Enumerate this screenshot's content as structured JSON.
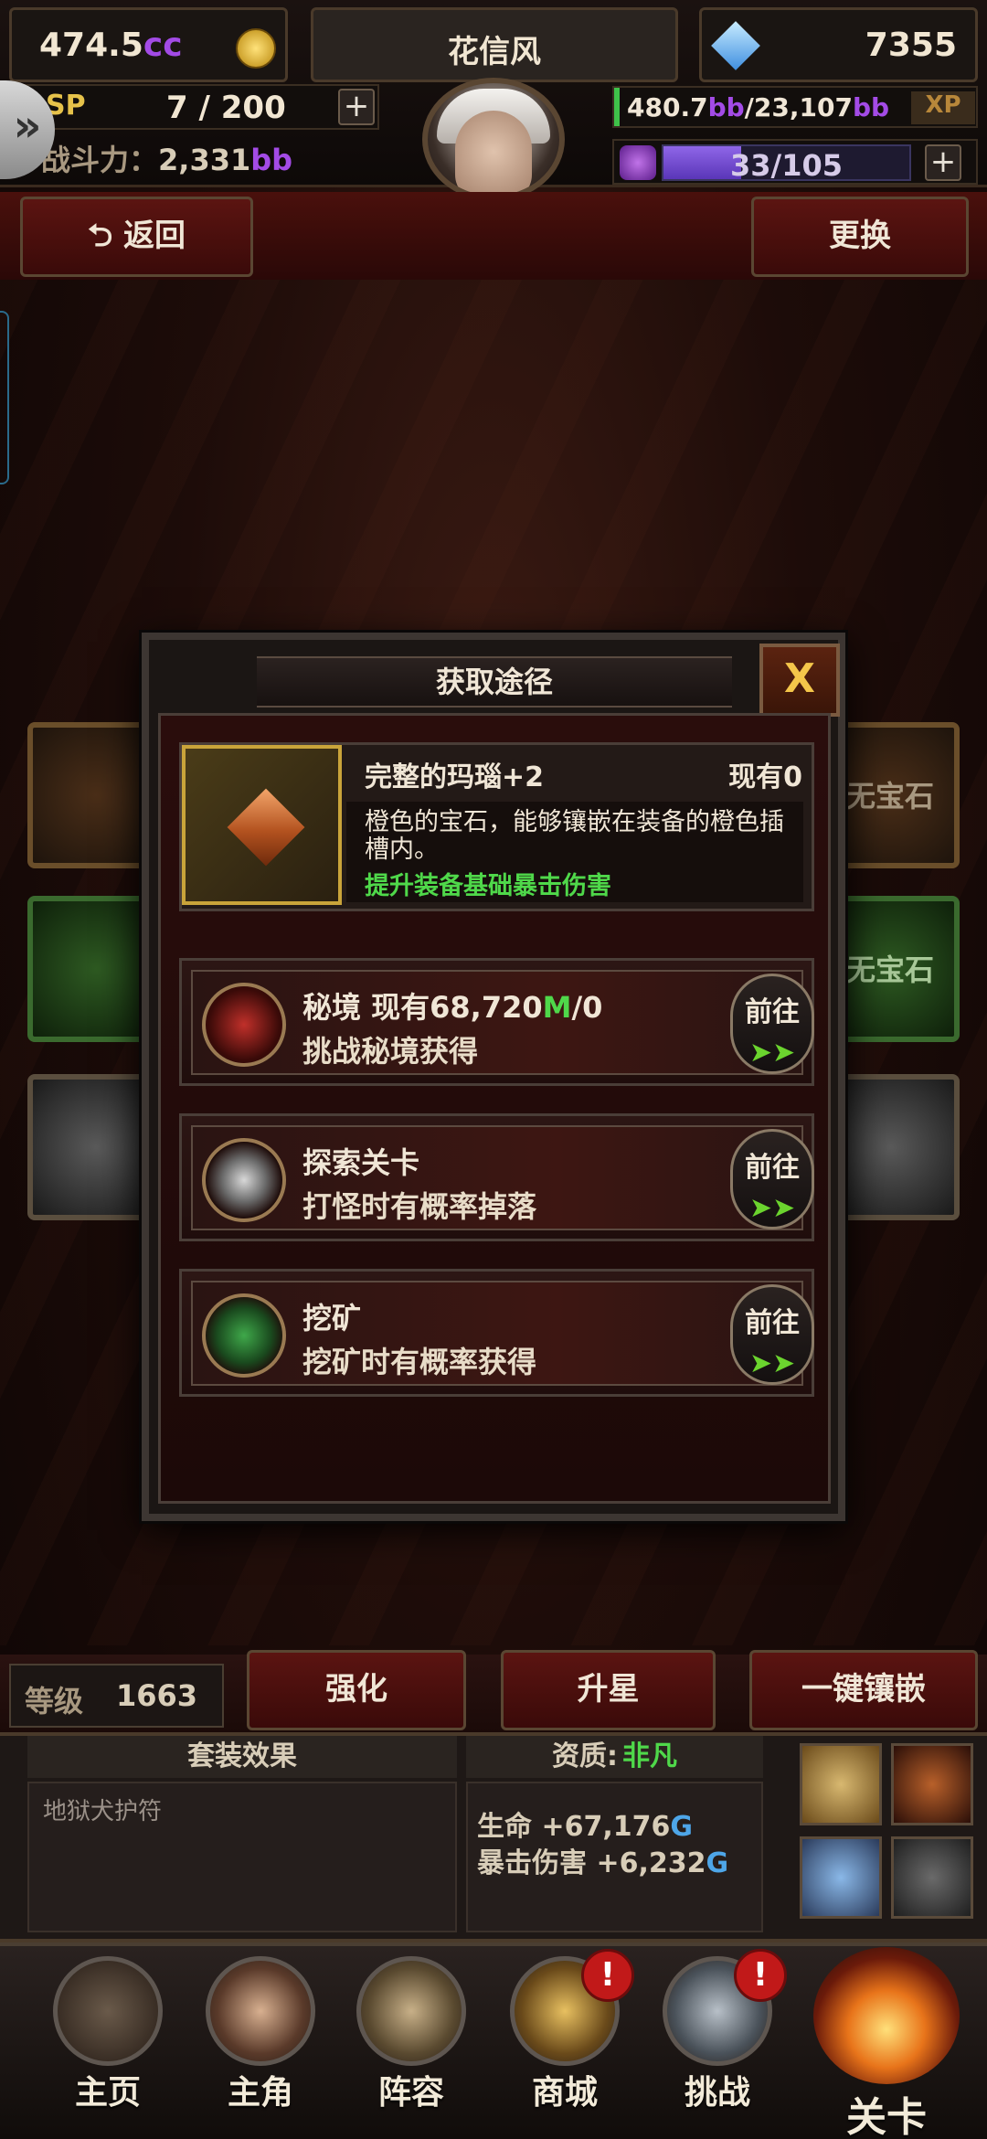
{
  "header": {
    "currency_cc": {
      "value": "474.5",
      "unit": "cc"
    },
    "player_name": "花信风",
    "diamonds": "7355",
    "sp_label": "SP",
    "sp_value": "7 / 200",
    "power_label": "战斗力：",
    "power_value": "2,331",
    "power_unit": "bb",
    "xp_current": "480.7",
    "xp_unit": "bb",
    "xp_sep": "/",
    "xp_max": "23,107",
    "xp_label": "XP",
    "gem_count": "33",
    "gem_max": "/105",
    "plus": "+"
  },
  "nav_top": {
    "back_label": "返回",
    "swap_label": "更换"
  },
  "dialog": {
    "title": "获取途径",
    "close": "X",
    "item": {
      "name": "完整的玛瑙+2",
      "owned": "现有0",
      "desc": "橙色的宝石，能够镶嵌在装备的橙色插槽内。",
      "effect": "提升装备基础暴击伤害"
    },
    "routes": [
      {
        "title": "秘境 现有68,720",
        "title_unit": "M",
        "title_tail": "/0",
        "sub": "挑战秘境获得",
        "go": "前往",
        "icon": "secret-realm-icon"
      },
      {
        "title": "探索关卡",
        "sub": "打怪时有概率掉落",
        "go": "前往",
        "icon": "skull-swords-icon"
      },
      {
        "title": "挖矿",
        "sub": "挖矿时有概率获得",
        "go": "前往",
        "icon": "pickaxe-ore-icon"
      }
    ]
  },
  "side_tiles": {
    "right_label": "无宝石"
  },
  "actions": {
    "level_label": "等级",
    "level_value": "1663",
    "enhance": "强化",
    "star_up": "升星",
    "auto_inlay": "一键镶嵌"
  },
  "stats": {
    "set_header": "套装效果",
    "set_name": "地狱犬护符",
    "quality_label": "资质:",
    "quality_value": "非凡",
    "hp_label": "生命",
    "hp_value": "+67,176",
    "hp_unit": "G",
    "crit_label": "暴击伤害",
    "crit_value": "+6,232",
    "crit_unit": "G"
  },
  "bottom_nav": [
    {
      "label": "主页",
      "icon": "castle-icon"
    },
    {
      "label": "主角",
      "icon": "hero-icon"
    },
    {
      "label": "阵容",
      "icon": "helmet-icon"
    },
    {
      "label": "商城",
      "icon": "chest-icon",
      "badge": "!"
    },
    {
      "label": "挑战",
      "icon": "swords-icon",
      "badge": "!"
    },
    {
      "label": "关卡",
      "icon": "flame-icon"
    }
  ],
  "colors": {
    "accent_purple": "#a34be6",
    "accent_green": "#4fd84a",
    "accent_blue": "#4ea6e8",
    "gold_frame": "#c9a43a"
  }
}
